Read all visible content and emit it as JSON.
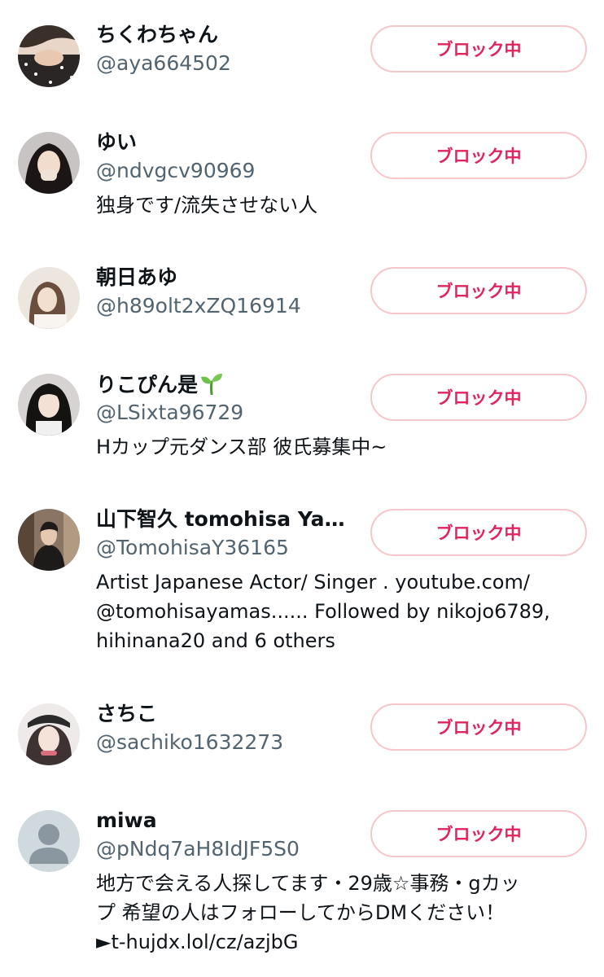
{
  "button_label": "ブロック中",
  "colors": {
    "block_text": "#e0245e",
    "block_border": "#f7c6cb",
    "handle": "#536471",
    "text": "#0f1419"
  },
  "users": [
    {
      "name": "ちくわちゃん",
      "handle": "@aya664502",
      "bio": []
    },
    {
      "name": "ゆい",
      "handle": "@ndvgcv90969",
      "bio": [
        "独身です/流失させない人"
      ]
    },
    {
      "name": "朝日あゆ",
      "handle": "@h89olt2xZQ16914",
      "bio": []
    },
    {
      "name": "りこぴん是",
      "name_icon": "seedling-icon",
      "handle": "@LSixta96729",
      "bio": [
        "Hカップ元ダンス部 彼氏募集中~"
      ]
    },
    {
      "name": "山下智久 tomohisa Yam...",
      "handle": "@TomohisaY36165",
      "bio": [
        "Artist Japanese Actor/ Singer . youtube.com/",
        "@tomohisayamas...... Followed by nikojo6789,",
        "hihinana20 and 6 others"
      ]
    },
    {
      "name": "さちこ",
      "handle": "@sachiko1632273",
      "bio": []
    },
    {
      "name": "miwa",
      "handle": "@pNdq7aH8IdJF5S0",
      "avatar_icon": "default-person-icon",
      "bio": [
        "地方で会える人探してます・29歳☆事務・gカッ",
        "プ 希望の人はフォローしてからDMください！",
        "►t-hujdx.lol/cz/azjbG"
      ]
    }
  ]
}
